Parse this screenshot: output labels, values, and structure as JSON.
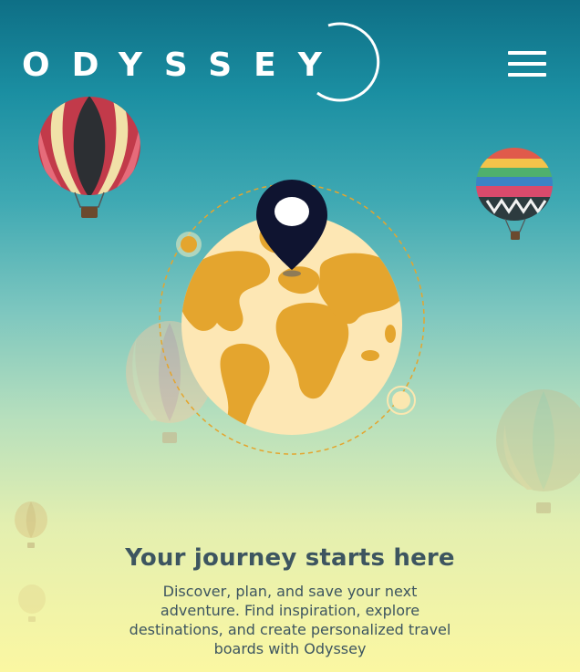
{
  "header": {
    "logo_text": "ODYSSEY",
    "menu_icon": "hamburger-menu-icon"
  },
  "hero": {
    "illustration": "globe-with-location-pin",
    "icons": [
      "globe-icon",
      "location-pin-icon"
    ],
    "background_balloons": 6
  },
  "content": {
    "headline": "Your journey starts here",
    "description": "Discover, plan, and save your next adventure. Find inspiration, explore destinations, and create personalized travel boards with Odyssey"
  },
  "colors": {
    "sky_top": "#0e6f86",
    "sky_bottom": "#fbf7a2",
    "globe_land": "#e4a52e",
    "globe_water": "#fde7b4",
    "pin": "#0f1430",
    "text": "#3d5560"
  }
}
